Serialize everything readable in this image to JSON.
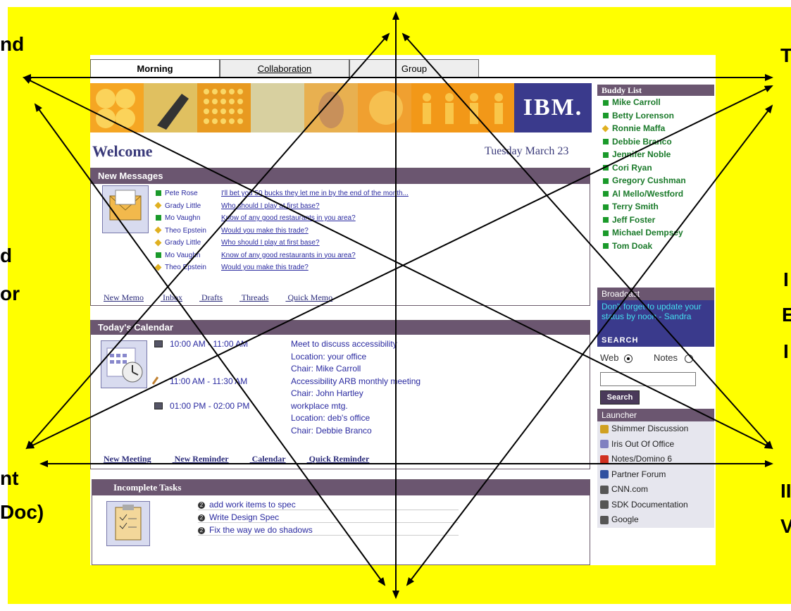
{
  "edges": {
    "top_left": "nd",
    "mid_left_1": "d",
    "mid_left_2": "or",
    "bottom_left_1": "nt",
    "bottom_left_2": "Doc)",
    "top_right": "T",
    "mid_right_1": "I",
    "mid_right_2": "E",
    "mid_right_3": "I",
    "bottom_right_1": "II",
    "bottom_right_2": "V"
  },
  "tabs": [
    "Morning",
    "Collaboration",
    "Group"
  ],
  "banner": {
    "logo": "IBM."
  },
  "welcome": "Welcome",
  "date": "Tuesday March 23",
  "messages": {
    "title": "New Messages",
    "rows": [
      {
        "sender": "Pete Rose",
        "subject": "I'll bet you 50 bucks they let me in by the end of the month...",
        "icon": "green-square"
      },
      {
        "sender": "Grady Little",
        "subject": "Who should I play at first base?",
        "icon": "yellow-diamond"
      },
      {
        "sender": "Mo Vaughn",
        "subject": "Know of any good restaurants in you area?",
        "icon": "green-square"
      },
      {
        "sender": "Theo Epstein",
        "subject": "Would you make this trade?",
        "icon": "yellow-diamond"
      },
      {
        "sender": "Grady Little",
        "subject": "Who should I play at first base?",
        "icon": "yellow-diamond"
      },
      {
        "sender": "Mo Vaughn",
        "subject": "Know of any good restaurants in you area?",
        "icon": "green-square"
      },
      {
        "sender": "Theo Epstein",
        "subject": "Would you make this trade?",
        "icon": "yellow-diamond"
      }
    ],
    "links": [
      "New Memo",
      "Inbox",
      "Drafts",
      "Threads",
      "Quick Memo"
    ]
  },
  "calendar": {
    "title": "Today's Calendar",
    "lines": [
      {
        "time": "10:00 AM -  11:00 AM",
        "text": "Meet to discuss accessibility",
        "icon": "meeting-icon"
      },
      {
        "time": "",
        "text": "Location: your office",
        "icon": ""
      },
      {
        "time": "",
        "text": "Chair: Mike Carroll",
        "icon": ""
      },
      {
        "time": "11:00 AM -  11:30 AM",
        "text": "Accessibility ARB monthly meeting",
        "icon": "pencil-icon"
      },
      {
        "time": "",
        "text": "Chair: John Hartley",
        "icon": ""
      },
      {
        "time": "01:00 PM -  02:00 PM",
        "text": "workplace mtg.",
        "icon": "meeting-icon"
      },
      {
        "time": "",
        "text": "Location: deb's office",
        "icon": ""
      },
      {
        "time": "",
        "text": "Chair: Debbie Branco",
        "icon": ""
      }
    ],
    "links": [
      "New Meeting",
      "New Reminder",
      "Calendar",
      "Quick Reminder"
    ]
  },
  "tasks": {
    "title": "Incomplete Tasks",
    "items": [
      "add work items to spec",
      "Write Design Spec",
      "Fix the way we do shadows"
    ]
  },
  "buddy_list": {
    "title": "Buddy List",
    "items": [
      {
        "name": "Mike Carroll",
        "status": "green"
      },
      {
        "name": "Betty Lorenson",
        "status": "green"
      },
      {
        "name": "Ronnie Maffa",
        "status": "yellow"
      },
      {
        "name": "Debbie Branco",
        "status": "green"
      },
      {
        "name": "Jennifer Noble",
        "status": "green"
      },
      {
        "name": "Cori Ryan",
        "status": "green"
      },
      {
        "name": "Gregory Cushman",
        "status": "green"
      },
      {
        "name": "Al Mello/Westford",
        "status": "green"
      },
      {
        "name": "Terry Smith",
        "status": "green"
      },
      {
        "name": "Jeff Foster",
        "status": "green"
      },
      {
        "name": "Michael Dempsey",
        "status": "green"
      },
      {
        "name": "Tom Doak",
        "status": "green"
      }
    ]
  },
  "broadcast": {
    "title": "Broadcast",
    "text": "Don't forget to update your status by noon - Sandra"
  },
  "search": {
    "title": "SEARCH",
    "option_web": "Web",
    "option_notes": "Notes",
    "button": "Search"
  },
  "launcher": {
    "title": "Launcher",
    "items": [
      "Shimmer Discussion",
      "Iris Out Of Office",
      "Notes/Domino 6",
      "Partner Forum",
      "CNN.com",
      "SDK Documentation",
      "Google"
    ]
  },
  "colors": {
    "slide_background": "#ffff00",
    "panel_header": "#6b5670",
    "ibm_blue": "#3a3a8c",
    "buddy_green": "#1a7a2a",
    "link_blue": "#2a2aa0"
  }
}
